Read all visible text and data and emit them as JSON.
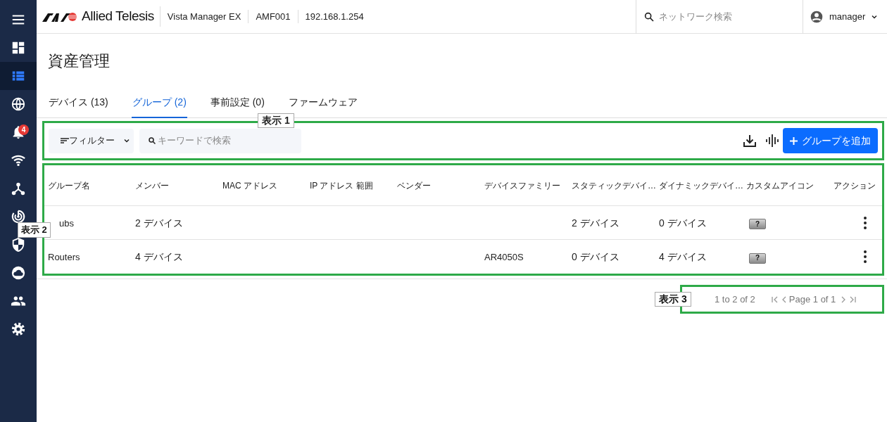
{
  "sidebar": {
    "items": [
      {
        "kind": "menu",
        "selected": false
      },
      {
        "kind": "dashboard",
        "selected": false
      },
      {
        "kind": "list",
        "selected": true
      },
      {
        "kind": "globe",
        "selected": false
      },
      {
        "kind": "bell",
        "selected": false,
        "badge": "4"
      },
      {
        "kind": "wifi",
        "selected": false
      },
      {
        "kind": "hub",
        "selected": false
      },
      {
        "kind": "radar",
        "selected": false
      },
      {
        "kind": "shield",
        "selected": false
      },
      {
        "kind": "cloud",
        "selected": false
      },
      {
        "kind": "people",
        "selected": false
      },
      {
        "kind": "gear",
        "selected": false
      }
    ]
  },
  "header": {
    "logo_text": "Allied Telesis",
    "product": "Vista Manager EX",
    "area": "AMF001",
    "address": "192.168.1.254",
    "search_placeholder": "ネットワーク検索",
    "user": "manager"
  },
  "page_title": "資産管理",
  "tabs": [
    {
      "label": "デバイス (13)",
      "selected": false
    },
    {
      "label": "グループ (2)",
      "selected": true
    },
    {
      "label": "事前設定 (0)",
      "selected": false
    },
    {
      "label": "ファームウェア",
      "selected": false
    }
  ],
  "toolbar": {
    "filter": "フィルター",
    "search_placeholder": "キーワードで検索",
    "add_button": "グループを追加"
  },
  "table": {
    "columns": [
      "グループ名",
      "メンバー",
      "MAC アドレス",
      "IP アドレス 範囲",
      "ベンダー",
      "デバイスファミリー",
      "スタティックデバイ…",
      "ダイナミックデバイ…",
      "カスタムアイコン",
      "アクション"
    ],
    "rows": [
      {
        "group_name": "ubs",
        "members": "2 デバイス",
        "static_devices": "2 デバイス",
        "dynamic_devices": "0 デバイス",
        "custom_icon": "?"
      },
      {
        "group_name": "Routers",
        "members": "4 デバイス",
        "device_family": "AR4050S",
        "static_devices": "0 デバイス",
        "dynamic_devices": "4 デバイス",
        "custom_icon": "?"
      }
    ]
  },
  "pagination": {
    "range": "1 to 2 of 2",
    "page": "Page 1 of 1"
  },
  "annotations": [
    {
      "label": "表示 1"
    },
    {
      "label": "表示 2"
    },
    {
      "label": "表示 3"
    }
  ]
}
